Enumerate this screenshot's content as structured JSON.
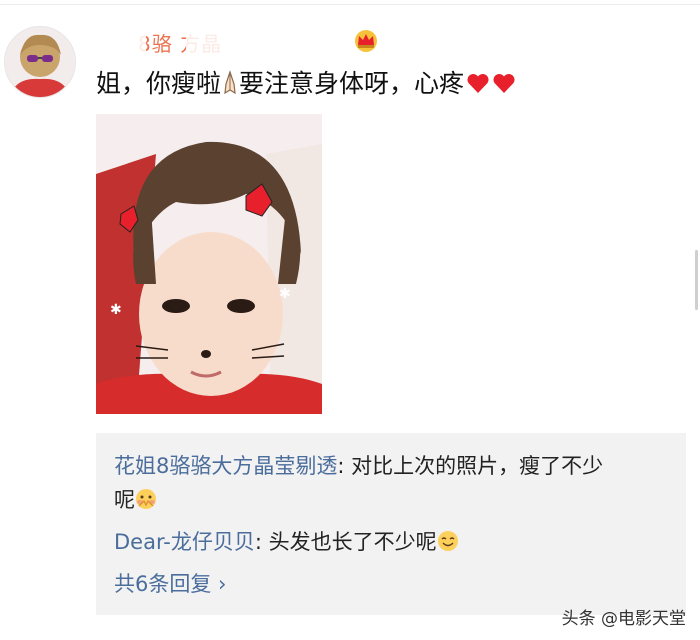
{
  "comment": {
    "username_visible": "8骆    方晶",
    "avatar_icon": "user-avatar",
    "vip_badge_icon": "crown-icon",
    "text": "姐，你瘦啦",
    "text2": "要注意身体呀，心疼",
    "emoji_icons": [
      "pray-hands-icon",
      "heart-icon",
      "heart-icon"
    ],
    "photo": "selfie-photo"
  },
  "replies": {
    "items": [
      {
        "name": "花姐8骆骆大方晶莹剔透",
        "text": ": 对比上次的照片，瘦了不少",
        "text_cont": "呢",
        "emoji": "shy-face-icon"
      },
      {
        "name": "Dear-龙仔贝贝",
        "text": ": 头发也长了不少呢",
        "emoji": "smile-face-icon"
      }
    ],
    "more_label": "共6条回复 ›"
  },
  "watermark": "头条 @电影天堂",
  "colors": {
    "username": "#eb7350",
    "link": "#4a6d9c",
    "reply_bg": "#f2f2f2",
    "heart": "#e8202c"
  }
}
